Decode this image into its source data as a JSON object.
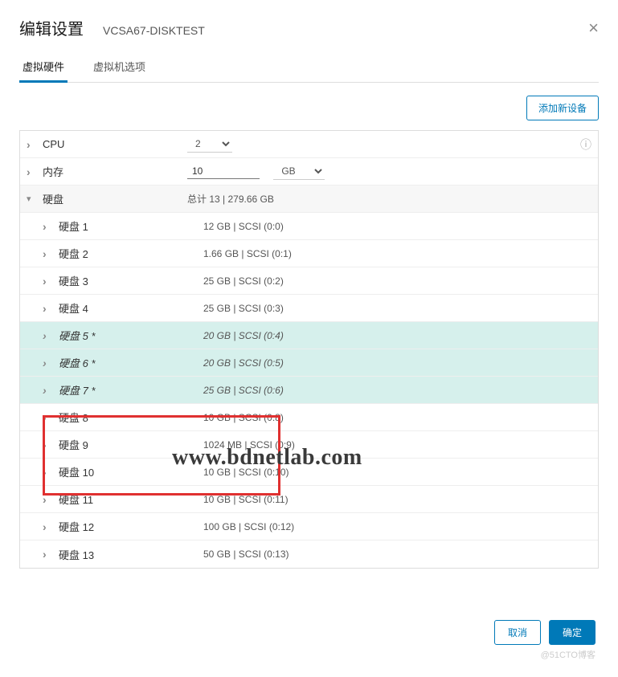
{
  "header": {
    "title": "编辑设置",
    "subtitle": "VCSA67-DISKTEST",
    "close": "×"
  },
  "tabs": {
    "hardware": "虚拟硬件",
    "options": "虚拟机选项"
  },
  "toolbar": {
    "add_device": "添加新设备"
  },
  "rows": {
    "cpu": {
      "label": "CPU",
      "value": "2"
    },
    "memory": {
      "label": "内存",
      "value": "10",
      "unit": "GB"
    },
    "disks_header": {
      "label": "硬盘",
      "summary": "总计 13 | 279.66 GB"
    },
    "disks": [
      {
        "label": "硬盘 1",
        "value": "12 GB | SCSI (0:0)",
        "highlight": false
      },
      {
        "label": "硬盘 2",
        "value": "1.66 GB | SCSI (0:1)",
        "highlight": false
      },
      {
        "label": "硬盘 3",
        "value": "25 GB | SCSI (0:2)",
        "highlight": false
      },
      {
        "label": "硬盘 4",
        "value": "25 GB | SCSI (0:3)",
        "highlight": false
      },
      {
        "label": "硬盘 5 *",
        "value": "20 GB | SCSI (0:4)",
        "highlight": true
      },
      {
        "label": "硬盘 6 *",
        "value": "20 GB | SCSI (0:5)",
        "highlight": true
      },
      {
        "label": "硬盘 7 *",
        "value": "25 GB | SCSI (0:6)",
        "highlight": true
      },
      {
        "label": "硬盘 8",
        "value": "10 GB | SCSI (0:8)",
        "highlight": false
      },
      {
        "label": "硬盘 9",
        "value": "1024 MB | SCSI (0:9)",
        "highlight": false
      },
      {
        "label": "硬盘 10",
        "value": "10 GB | SCSI (0:10)",
        "highlight": false
      },
      {
        "label": "硬盘 11",
        "value": "10 GB | SCSI (0:11)",
        "highlight": false
      },
      {
        "label": "硬盘 12",
        "value": "100 GB | SCSI (0:12)",
        "highlight": false
      },
      {
        "label": "硬盘 13",
        "value": "50 GB | SCSI (0:13)",
        "highlight": false
      }
    ]
  },
  "watermark": "www.bdnetlab.com",
  "footer": {
    "cancel": "取消",
    "ok": "确定",
    "watermark": "@51CTO博客"
  }
}
